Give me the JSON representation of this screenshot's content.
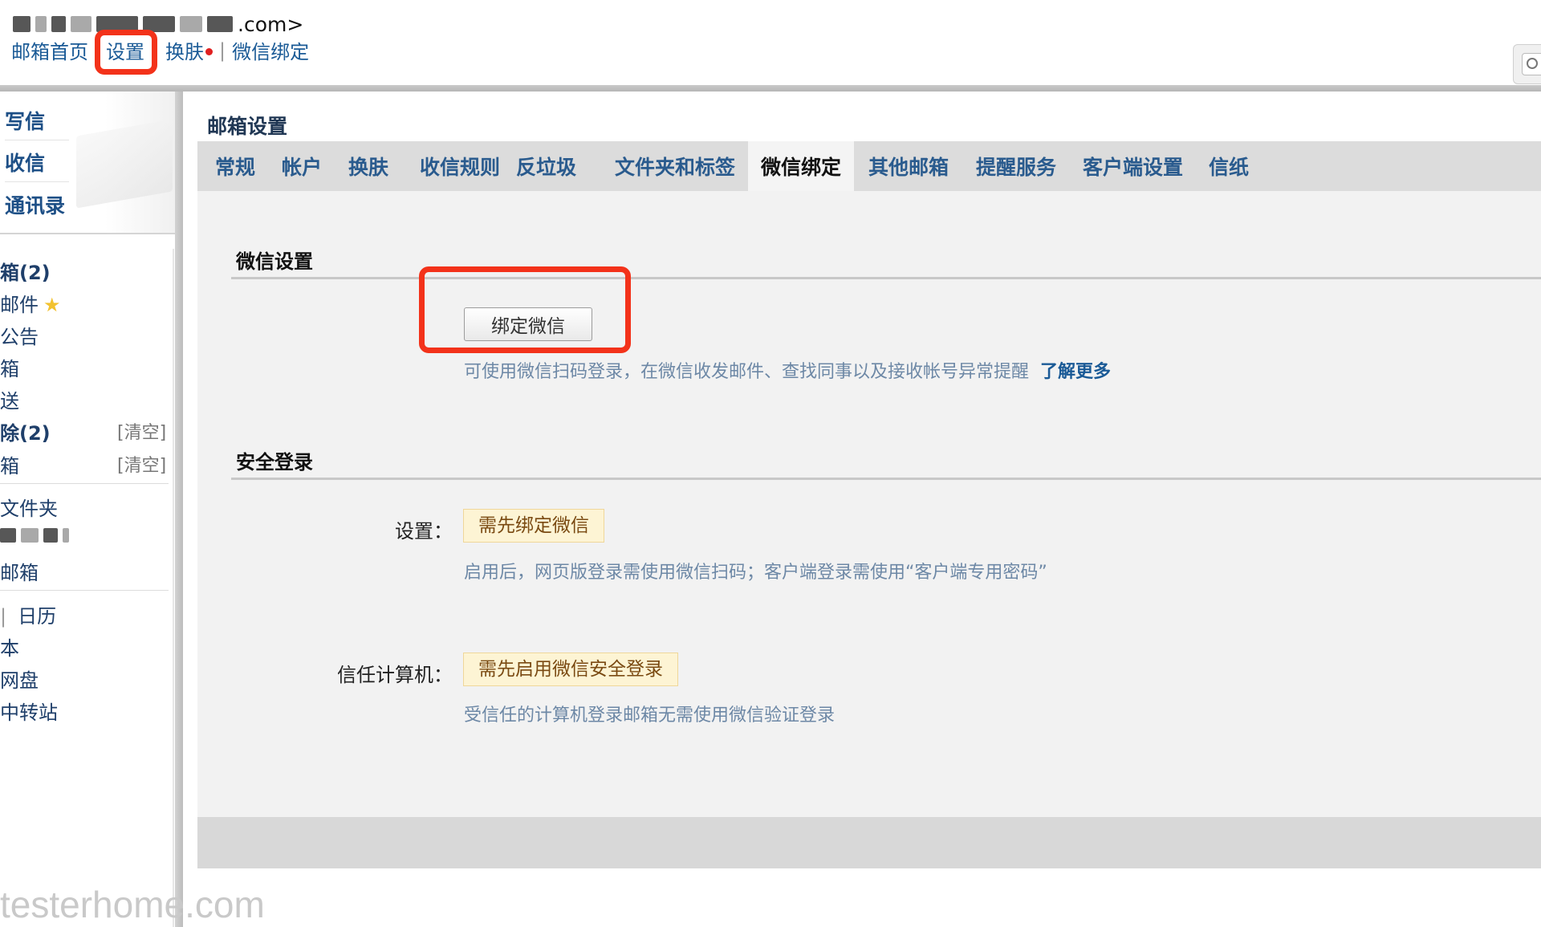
{
  "header": {
    "account_suffix": ".com>",
    "nav": {
      "home": "邮箱首页",
      "settings": "设置",
      "skin": "换肤",
      "wechat_bind": "微信绑定",
      "sep": "|"
    }
  },
  "sidebar": {
    "actions": {
      "compose": "写信",
      "receive": "收信",
      "contacts": "通讯录"
    },
    "folders": {
      "inbox": "箱(2)",
      "starred": "邮件",
      "notice": "公告",
      "drafts": "箱",
      "sent": "送",
      "deleted": "除(2)",
      "trash": "箱",
      "my_folders": "文件夹",
      "other_mail": "邮箱",
      "calendar_sep": "|",
      "calendar": "日历",
      "notepad": "本",
      "netdisk": "网盘",
      "transfer": "中转站"
    },
    "clear": "[清空]"
  },
  "main": {
    "title": "邮箱设置",
    "tabs": [
      "常规",
      "帐户",
      "换肤",
      "收信规则",
      "反垃圾",
      "文件夹和标签",
      "微信绑定",
      "其他邮箱",
      "提醒服务",
      "客户端设置",
      "信纸"
    ],
    "active_tab": "微信绑定",
    "wechat": {
      "section_title": "微信设置",
      "bind_button": "绑定微信",
      "hint": "可使用微信扫码登录，在微信收发邮件、查找同事以及接收帐号异常提醒",
      "learn_more": "了解更多"
    },
    "security": {
      "section_title": "安全登录",
      "setting_label": "设置：",
      "setting_badge": "需先绑定微信",
      "setting_hint": "启用后，网页版登录需使用微信扫码；客户端登录需使用“客户端专用密码”",
      "trusted_label": "信任计算机：",
      "trusted_badge": "需先启用微信安全登录",
      "trusted_hint": "受信任的计算机登录邮箱无需使用微信验证登录"
    }
  },
  "watermark": "testerhome.com",
  "colors": {
    "highlight": "#f3321a",
    "link": "#1a5a96",
    "badge_bg": "#fdf4d4"
  }
}
